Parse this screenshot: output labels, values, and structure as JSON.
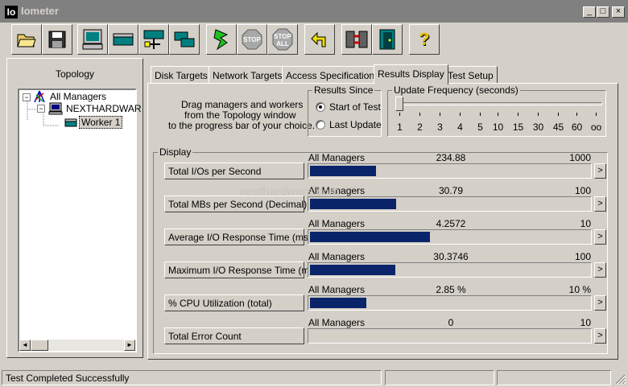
{
  "window": {
    "icon_text": "Io",
    "title": "Iometer",
    "controls": [
      "_",
      "□",
      "×"
    ]
  },
  "toolbar": {
    "buttons": [
      {
        "icon": "open-folder-icon"
      },
      {
        "icon": "save-disk-icon"
      },
      {
        "icon": "new-manager-icon"
      },
      {
        "icon": "new-worker-icon"
      },
      {
        "icon": "network-worker-icon"
      },
      {
        "icon": "duplicate-worker-icon"
      },
      {
        "icon": "start-green-flag-icon"
      },
      {
        "icon": "stop-icon",
        "text": "STOP"
      },
      {
        "icon": "stop-all-icon",
        "text": "STOP ALL"
      },
      {
        "icon": "reset-workers-icon"
      },
      {
        "icon": "disconnect-icon"
      },
      {
        "icon": "exit-door-icon"
      },
      {
        "icon": "help-icon",
        "text": "?"
      }
    ]
  },
  "topology": {
    "title": "Topology",
    "tree": [
      {
        "label": "All Managers",
        "level": 0,
        "expander": "−"
      },
      {
        "label": "NEXTHARDWAR",
        "level": 1,
        "expander": "−"
      },
      {
        "label": "Worker 1",
        "level": 2,
        "selected": true
      }
    ],
    "scroll_left": "◄",
    "scroll_right": "►"
  },
  "tabs": [
    {
      "label": "Disk Targets"
    },
    {
      "label": "Network Targets"
    },
    {
      "label": "Access Specifications"
    },
    {
      "label": "Results Display",
      "active": true
    },
    {
      "label": "Test Setup"
    }
  ],
  "results": {
    "instructions": [
      "Drag managers and workers",
      "from the Topology window",
      "to the progress bar of your choice."
    ],
    "results_since": {
      "title": "Results Since",
      "options": [
        {
          "label": "Start of Test",
          "selected": true
        },
        {
          "label": "Last Update",
          "selected": false
        }
      ]
    },
    "update_frequency": {
      "title": "Update Frequency (seconds)",
      "ticks": [
        "1",
        "2",
        "3",
        "4",
        "5",
        "10",
        "15",
        "30",
        "45",
        "60",
        "oo"
      ],
      "selected_index": 0
    },
    "display_title": "Display",
    "metrics": [
      {
        "label": "Total I/Os per Second",
        "source": "All Managers",
        "value": "234.88",
        "max": "1000",
        "fill": 0.2349
      },
      {
        "label": "Total MBs per Second (Decimal)",
        "source": "All Managers",
        "value": "30.79",
        "max": "100",
        "fill": 0.3079
      },
      {
        "label": "Average I/O Response Time (ms)",
        "source": "All Managers",
        "value": "4.2572",
        "max": "10",
        "fill": 0.4257
      },
      {
        "label": "Maximum I/O Response Time (ms)",
        "source": "All Managers",
        "value": "30.3746",
        "max": "100",
        "fill": 0.3037
      },
      {
        "label": "% CPU Utilization (total)",
        "source": "All Managers",
        "value": "2.85 %",
        "max": "10 %",
        "fill": 0.2
      },
      {
        "label": "Total Error Count",
        "source": "All Managers",
        "value": "0",
        "max": "10",
        "fill": 0
      }
    ],
    "arrow": ">"
  },
  "watermark": "nexthardware.com",
  "status": {
    "message": "Test Completed Successfully"
  },
  "colors": {
    "face": "#d4d0c8",
    "bar_fill": "#0a246a",
    "title_bar": "#808080"
  }
}
